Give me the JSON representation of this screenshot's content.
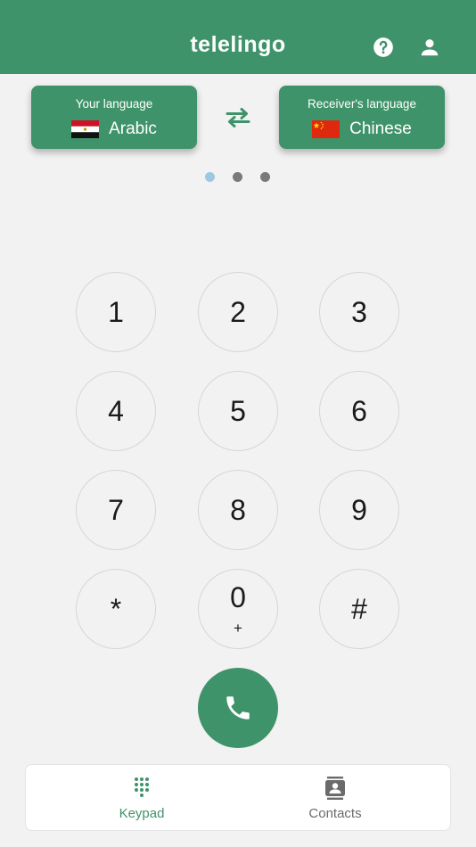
{
  "header": {
    "title": "telelingo",
    "help_icon": "help-circle-icon",
    "profile_icon": "person-icon"
  },
  "languages": {
    "source": {
      "caption": "Your language",
      "name": "Arabic",
      "flag": "egypt-flag-icon"
    },
    "target": {
      "caption": "Receiver's language",
      "name": "Chinese",
      "flag": "china-flag-icon"
    },
    "swap_icon": "swap-arrows-icon"
  },
  "pager": {
    "count": 3,
    "active": 0
  },
  "keypad": {
    "keys": [
      {
        "main": "1",
        "sub": ""
      },
      {
        "main": "2",
        "sub": ""
      },
      {
        "main": "3",
        "sub": ""
      },
      {
        "main": "4",
        "sub": ""
      },
      {
        "main": "5",
        "sub": ""
      },
      {
        "main": "6",
        "sub": ""
      },
      {
        "main": "7",
        "sub": ""
      },
      {
        "main": "8",
        "sub": ""
      },
      {
        "main": "9",
        "sub": ""
      },
      {
        "main": "*",
        "sub": ""
      },
      {
        "main": "0",
        "sub": "+"
      },
      {
        "main": "#",
        "sub": ""
      }
    ],
    "call_icon": "phone-icon"
  },
  "tabs": [
    {
      "label": "Keypad",
      "icon": "dialpad-icon",
      "active": true
    },
    {
      "label": "Contacts",
      "icon": "contacts-icon",
      "active": false
    }
  ],
  "colors": {
    "primary": "#3f936a",
    "background": "#f2f2f2",
    "active_dot": "#9cc8e4",
    "inactive_dot": "#7a7a7a"
  }
}
